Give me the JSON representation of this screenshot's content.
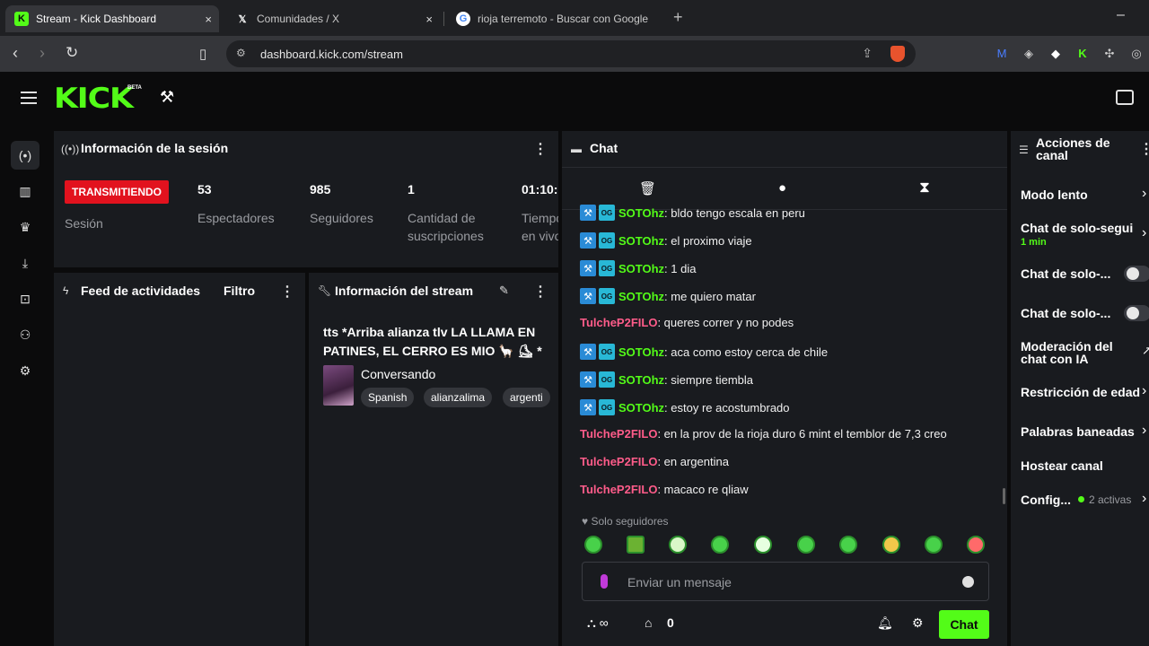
{
  "browser": {
    "tabs": [
      {
        "title": "Stream - Kick Dashboard",
        "close": "×"
      },
      {
        "title": "Comunidades / X",
        "close": "×"
      },
      {
        "title": "rioja terremoto - Buscar con Google",
        "close": ""
      }
    ],
    "new_tab": "+",
    "minimize": "–",
    "url": "dashboard.kick.com/stream"
  },
  "header": {
    "logo": "KICK",
    "beta": "BETA"
  },
  "session": {
    "title": "Información de la sesión",
    "status": "TRANSMITIENDO",
    "status_label": "Sesión",
    "stats": [
      {
        "value": "53",
        "label": "Espectadores"
      },
      {
        "value": "985",
        "label": "Seguidores"
      },
      {
        "value": "1",
        "label": "Cantidad de suscripciones"
      },
      {
        "value": "01:10:",
        "label": "Tiempo en vivo"
      }
    ]
  },
  "feed": {
    "title": "Feed de actividades",
    "filter": "Filtro"
  },
  "stream_info": {
    "title": "Información del stream",
    "stream_title": "tts *Arriba alianza tlv LA LLAMA EN PATINES, EL CERRO ES MIO 🦙 ⛸ *",
    "category": "Conversando",
    "tags": [
      "Spanish",
      "alianzalima",
      "argenti"
    ]
  },
  "chat": {
    "title": "Chat",
    "messages": [
      {
        "user": "SOTOhz",
        "badges": true,
        "text": ": bldo tengo escala en peru"
      },
      {
        "user": "SOTOhz",
        "badges": true,
        "text": ": el proximo viaje"
      },
      {
        "user": "SOTOhz",
        "badges": true,
        "text": ": 1 dia"
      },
      {
        "user": "SOTOhz",
        "badges": true,
        "text": ": me quiero matar"
      },
      {
        "user": "TulcheP2FILO",
        "badges": false,
        "text": ": queres correr y no podes"
      },
      {
        "user": "SOTOhz",
        "badges": true,
        "text": ": aca como estoy cerca de chile"
      },
      {
        "user": "SOTOhz",
        "badges": true,
        "text": ": siempre tiembla"
      },
      {
        "user": "SOTOhz",
        "badges": true,
        "text": ": estoy re acostumbrado"
      },
      {
        "user": "TulcheP2FILO",
        "badges": false,
        "text": ": en la prov de la rioja duro 6 mint el temblor de 7,3 creo"
      },
      {
        "user": "TulcheP2FILO",
        "badges": false,
        "text": ": en argentina"
      },
      {
        "user": "TulcheP2FILO",
        "badges": false,
        "text": ": macaco re qliaw"
      }
    ],
    "followers_only": "Solo seguidores",
    "input_placeholder": "Enviar un mensaje",
    "points": "0",
    "send_label": "Chat"
  },
  "actions": {
    "title": "Acciones de canal",
    "items": [
      {
        "label": "Modo lento"
      },
      {
        "label": "Chat de solo-segui",
        "sub": "1 min"
      },
      {
        "label": "Chat de solo-..."
      },
      {
        "label": "Chat de solo-..."
      },
      {
        "label": "Moderación del chat con IA"
      },
      {
        "label": "Restricción de edad"
      },
      {
        "label": "Palabras baneadas"
      },
      {
        "label": "Hostear canal"
      },
      {
        "label": "Config...",
        "sub": "2 activas"
      }
    ]
  },
  "colors": {
    "kick_green": "#53fc18",
    "live_red": "#e2121e",
    "user_green": "#53fc18",
    "user_pink": "#ff5c8a"
  }
}
